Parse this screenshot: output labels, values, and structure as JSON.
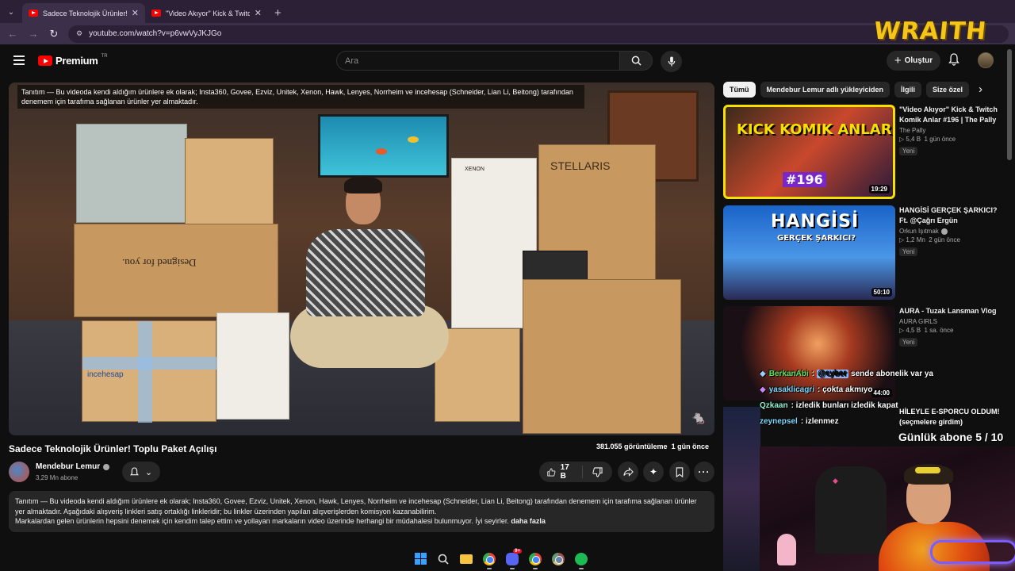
{
  "browser": {
    "tabs": [
      {
        "title": "Sadece Teknolojik Ürünler! Topl",
        "active": true
      },
      {
        "title": "\"Video Akıyor\" Kick & Twitch K",
        "active": false
      }
    ],
    "url": "youtube.com/watch?v=p6vwVyJKJGo"
  },
  "overlay": {
    "logo_text": "WRAITH",
    "daily_subs": "Günlük abone 5 / 10",
    "chat": [
      {
        "user": "BerkanAbi",
        "mention": "@cyber",
        "message": "sende abonelik var ya"
      },
      {
        "user": "yasaklicagri",
        "message": ": çokta akmıyo"
      },
      {
        "user": "Qzkaan",
        "message": ": izledik bunları izledik kapat"
      },
      {
        "user": "zeynepsel",
        "message": ": izlenmez"
      }
    ]
  },
  "header": {
    "brand": "Premium",
    "brand_tr": "TR",
    "search_placeholder": "Ara",
    "create_label": "Oluştur"
  },
  "video": {
    "overlay_text": "Tanıtım — Bu videoda kendi aldığım ürünlere ek olarak; Insta360, Govee, Ezviz, Unitek, Xenon, Hawk, Lenyes, Norrheim ve incehesap (Schneider, Lian Li, Beitong) tarafından denemem için tarafıma sağlanan ürünler yer almaktadır.",
    "box_labels": {
      "designed": "Designed for you.",
      "stellaris": "STELLARIS",
      "xenon": "XENON",
      "incehesap": "incehesap"
    },
    "title": "Sadece Teknolojik Ürünler! Toplu Paket Açılışı",
    "views": "381.055 görüntüleme",
    "age": "1 gün önce",
    "channel": "Mendebur Lemur",
    "subscribers": "3,29 Mn abone",
    "likes": "17 B",
    "description_line1": "Tanıtım — Bu videoda kendi aldığım ürünlere ek olarak; Insta360, Govee, Ezviz, Unitek, Xenon, Hawk, Lenyes, Norrheim ve incehesap (Schneider, Lian Li, Beitong) tarafından denemem için tarafıma sağlanan ürünler yer almaktadır. Aşağıdaki alışveriş linkleri satış ortaklığı linkleridir; bu linkler üzerinden yapılan alışverişlerden komisyon kazanabilirim.",
    "description_line2": "Markalardan gelen ürünlerin hepsini denemek için kendim talep ettim ve yollayan markaların video üzerinde herhangi bir müdahalesi bulunmuyor. İyi seyirler.",
    "more_label": "daha fazla"
  },
  "chips": [
    "Tümü",
    "Mendebur Lemur adlı yükleyiciden",
    "İlgili",
    "Size özel"
  ],
  "recommendations": [
    {
      "title": "\"Video Akıyor\" Kick & Twitch Komik Anlar #196 | The Pally",
      "channel": "The Pally",
      "views": "5,4 B",
      "age": "1 gün önce",
      "badge": "Yeni",
      "duration": "19:29",
      "thumb_title": "KICK KOMIK ANLAR",
      "thumb_num": "#196"
    },
    {
      "title": "HANGİSİ GERÇEK ŞARKICI? Ft. @Çağrı Ergün",
      "channel": "Orkun Işıtmak",
      "views": "1,2 Mn",
      "age": "2 gün önce",
      "badge": "Yeni",
      "duration": "50:10",
      "thumb_title": "HANGİSİ",
      "thumb_sub": "GERÇEK ŞARKICI?"
    },
    {
      "title": "AURA - Tuzak Lansman Vlog",
      "channel": "AURA GIRLS",
      "views": "4,5 B",
      "age": "1 sa. önce",
      "badge": "Yeni",
      "duration": "44:00"
    },
    {
      "title": "HİLEYLE E-SPORCU OLDUM! (seçmelere girdim)"
    }
  ],
  "colors": {
    "accent": "#ff0000",
    "background": "#0f0f0f",
    "overlay_logo": "#f5c518"
  }
}
